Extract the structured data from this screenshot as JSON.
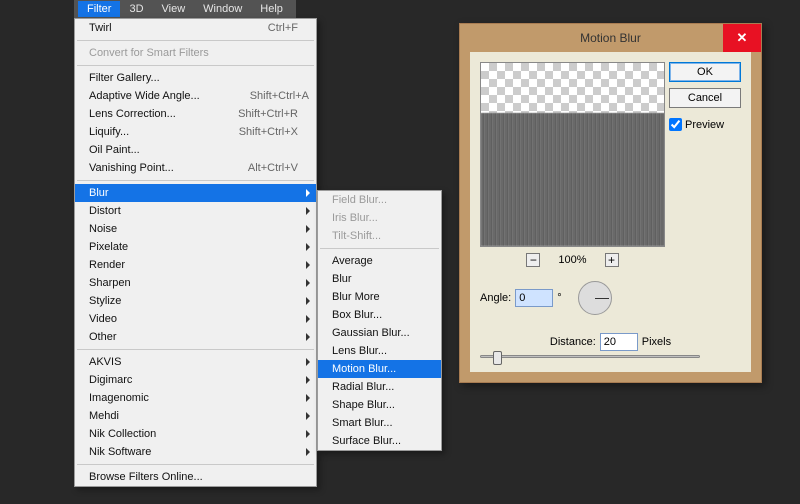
{
  "menubar": {
    "items": [
      "Filter",
      "3D",
      "View",
      "Window",
      "Help"
    ],
    "active_index": 0
  },
  "filter_menu": {
    "last_filter": {
      "label": "Twirl",
      "shortcut": "Ctrl+F"
    },
    "smart": {
      "label": "Convert for Smart Filters"
    },
    "group1": [
      {
        "label": "Filter Gallery..."
      },
      {
        "label": "Adaptive Wide Angle...",
        "shortcut": "Shift+Ctrl+A"
      },
      {
        "label": "Lens Correction...",
        "shortcut": "Shift+Ctrl+R"
      },
      {
        "label": "Liquify...",
        "shortcut": "Shift+Ctrl+X"
      },
      {
        "label": "Oil Paint..."
      },
      {
        "label": "Vanishing Point...",
        "shortcut": "Alt+Ctrl+V"
      }
    ],
    "categories": [
      {
        "label": "Blur",
        "highlight": true
      },
      {
        "label": "Distort"
      },
      {
        "label": "Noise"
      },
      {
        "label": "Pixelate"
      },
      {
        "label": "Render"
      },
      {
        "label": "Sharpen"
      },
      {
        "label": "Stylize"
      },
      {
        "label": "Video"
      },
      {
        "label": "Other"
      }
    ],
    "plugins": [
      {
        "label": "AKVIS"
      },
      {
        "label": "Digimarc"
      },
      {
        "label": "Imagenomic"
      },
      {
        "label": "Mehdi"
      },
      {
        "label": "Nik Collection"
      },
      {
        "label": "Nik Software"
      }
    ],
    "browse": {
      "label": "Browse Filters Online..."
    }
  },
  "blur_submenu": {
    "gallery": [
      {
        "label": "Field Blur..."
      },
      {
        "label": "Iris Blur..."
      },
      {
        "label": "Tilt-Shift..."
      }
    ],
    "items": [
      {
        "label": "Average"
      },
      {
        "label": "Blur"
      },
      {
        "label": "Blur More"
      },
      {
        "label": "Box Blur..."
      },
      {
        "label": "Gaussian Blur..."
      },
      {
        "label": "Lens Blur..."
      },
      {
        "label": "Motion Blur...",
        "highlight": true
      },
      {
        "label": "Radial Blur..."
      },
      {
        "label": "Shape Blur..."
      },
      {
        "label": "Smart Blur..."
      },
      {
        "label": "Surface Blur..."
      }
    ]
  },
  "dialog": {
    "title": "Motion Blur",
    "ok": "OK",
    "cancel": "Cancel",
    "preview_label": "Preview",
    "preview_checked": true,
    "zoom": {
      "minus": "−",
      "level": "100%",
      "plus": "+"
    },
    "angle_label": "Angle:",
    "angle_value": "0",
    "angle_unit": "°",
    "distance_label": "Distance:",
    "distance_value": "20",
    "distance_unit": "Pixels"
  }
}
